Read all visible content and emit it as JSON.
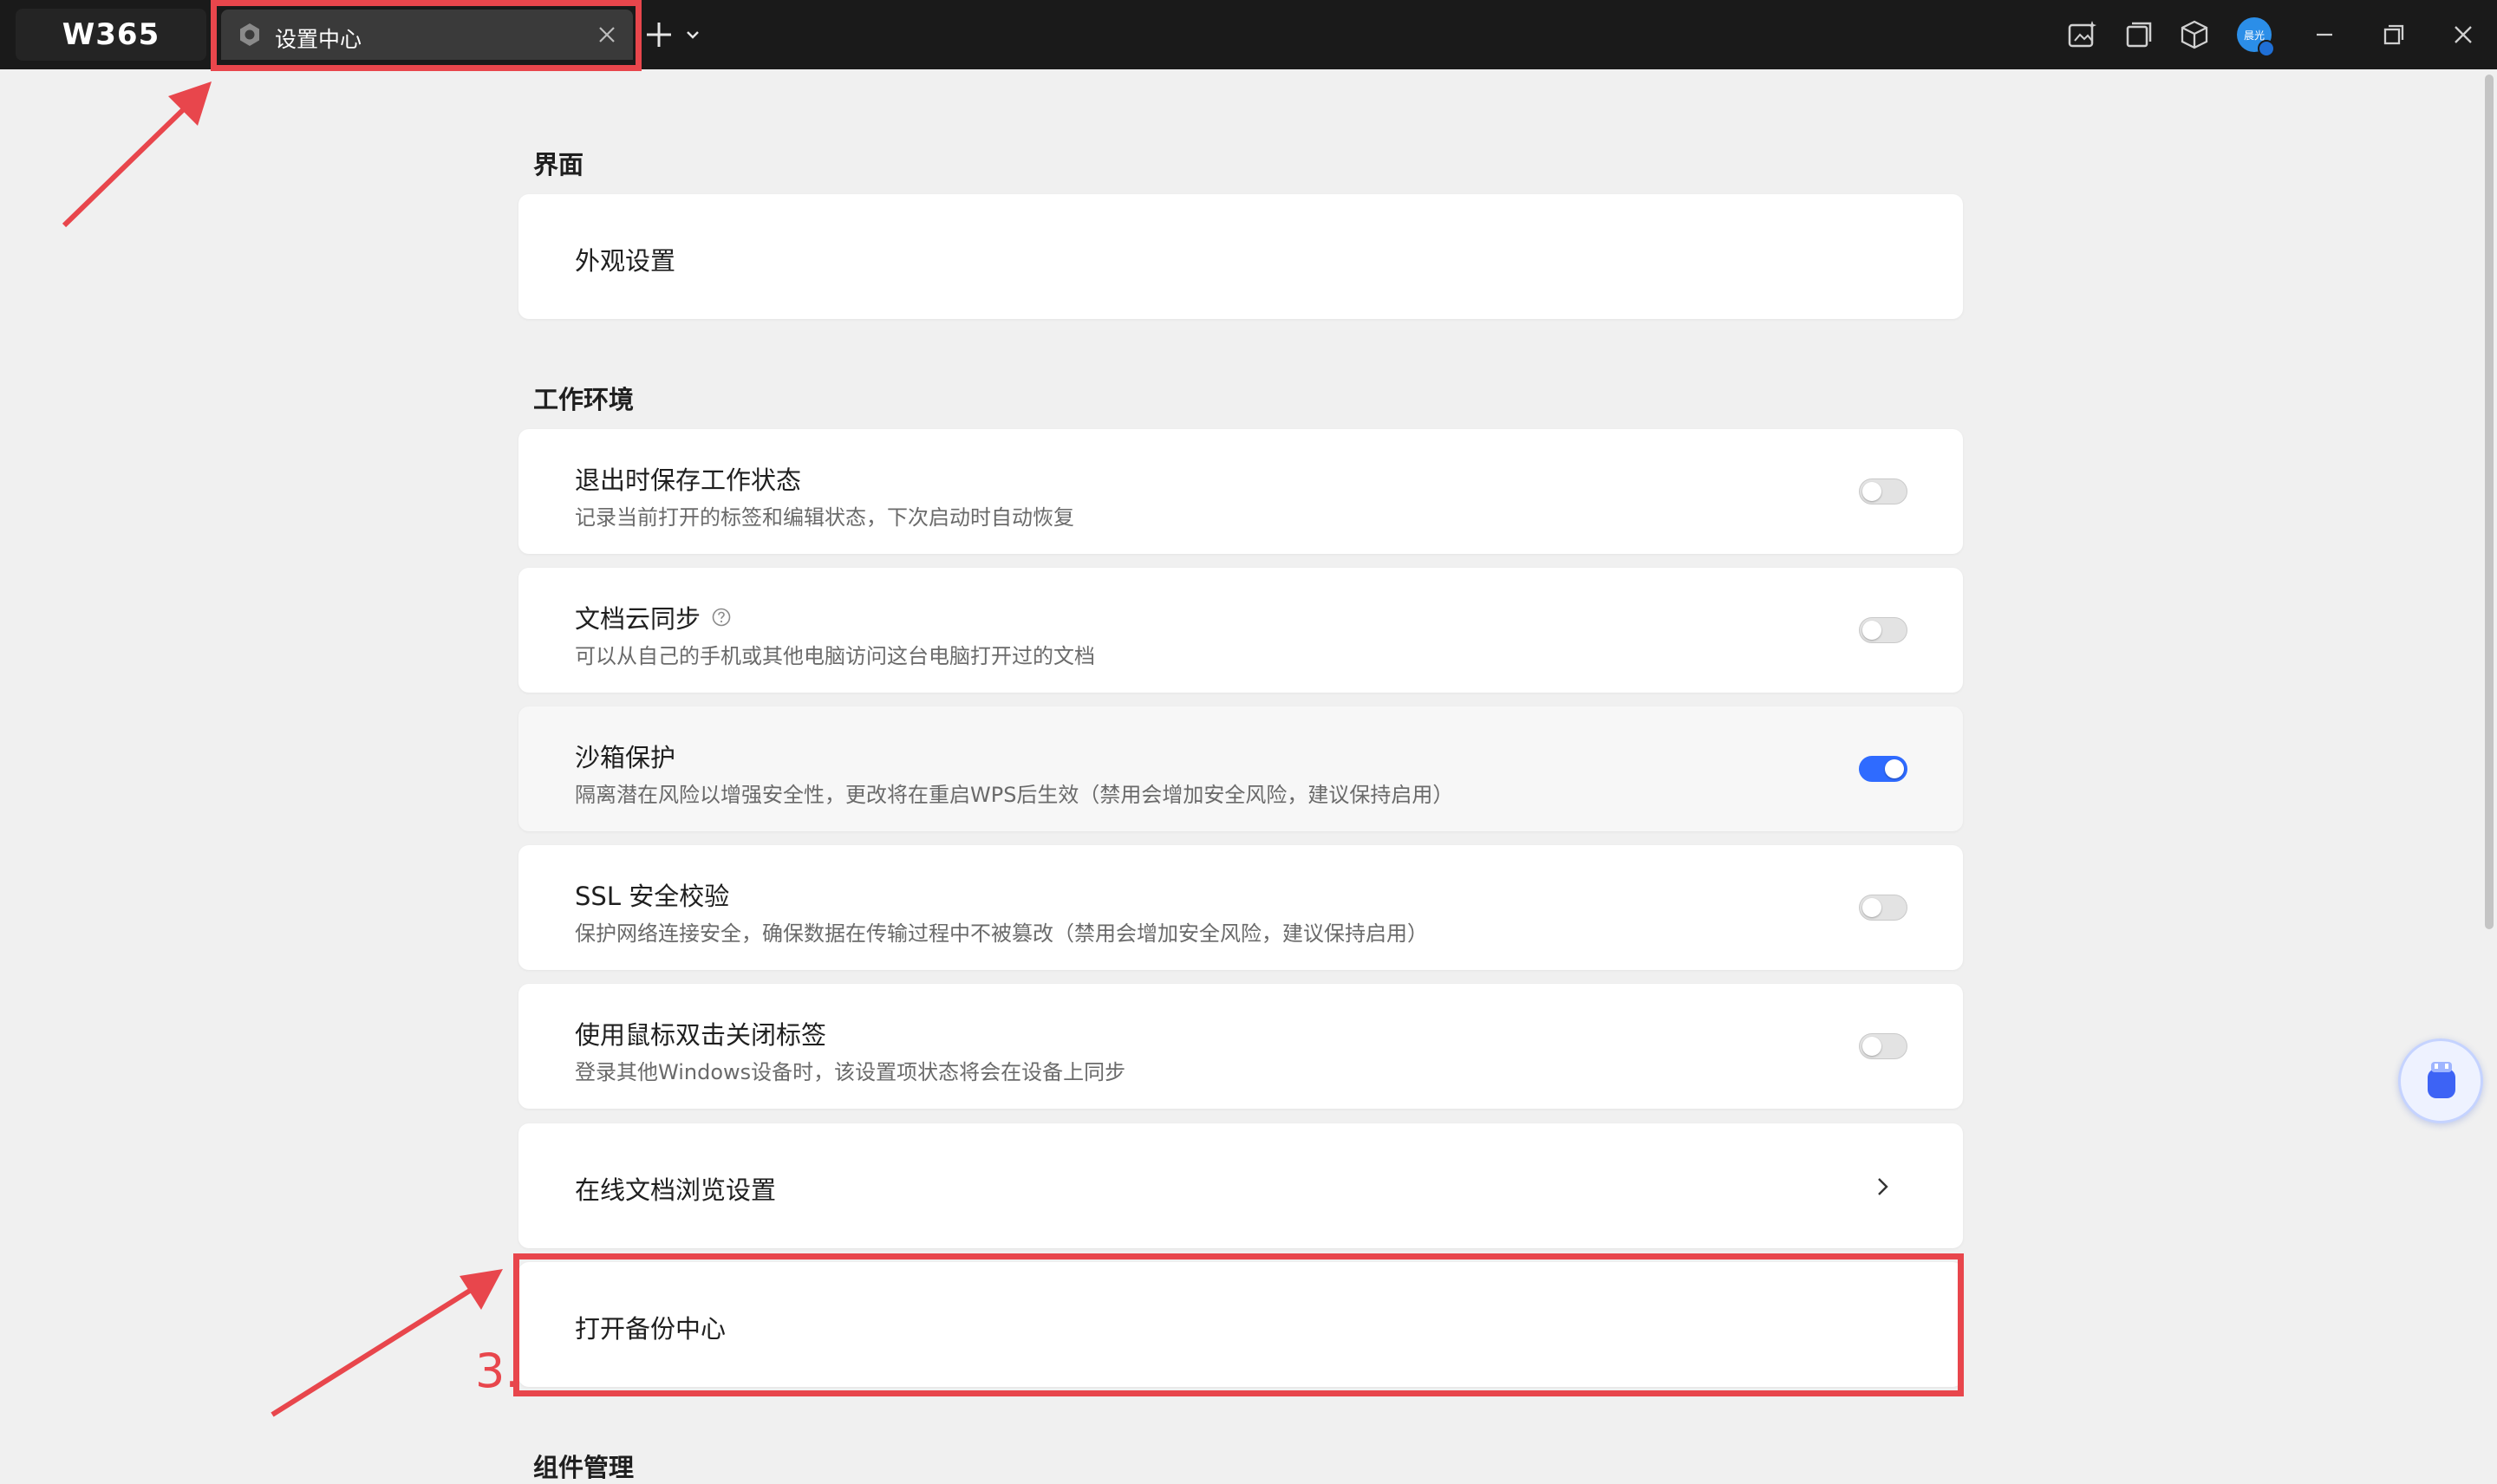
{
  "app": {
    "logo": "W365"
  },
  "tab": {
    "title": "设置中心"
  },
  "user": {
    "avatar_text": "晨光"
  },
  "sections": {
    "interface": {
      "title": "界面"
    },
    "workspace": {
      "title": "工作环境"
    },
    "components": {
      "title": "组件管理"
    }
  },
  "settings": {
    "appearance": {
      "title": "外观设置"
    },
    "save_state": {
      "title": "退出时保存工作状态",
      "desc": "记录当前打开的标签和编辑状态，下次启动时自动恢复",
      "enabled": false
    },
    "cloud_sync": {
      "title": "文档云同步",
      "desc": "可以从自己的手机或其他电脑访问这台电脑打开过的文档",
      "enabled": false
    },
    "sandbox": {
      "title": "沙箱保护",
      "desc": "隔离潜在风险以增强安全性，更改将在重启WPS后生效（禁用会增加安全风险，建议保持启用）",
      "enabled": true
    },
    "ssl": {
      "title": "SSL 安全校验",
      "desc": "保护网络连接安全，确保数据在传输过程中不被篡改（禁用会增加安全风险，建议保持启用）",
      "enabled": false
    },
    "dblclick_close": {
      "title": "使用鼠标双击关闭标签",
      "desc": "登录其他Windows设备时，该设置项状态将会在设备上同步",
      "enabled": false
    },
    "online_browse": {
      "title": "在线文档浏览设置"
    },
    "backup_center": {
      "title": "打开备份中心"
    }
  },
  "annotation": {
    "step_number": "3.",
    "color": "#e8464c"
  },
  "colors": {
    "accent": "#2f6bff",
    "titlebar": "#1a1a1a",
    "background": "#f0f0f0"
  }
}
